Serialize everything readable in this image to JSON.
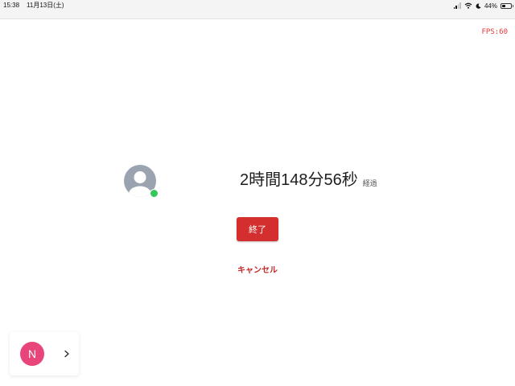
{
  "status_bar": {
    "time": "15:38",
    "date": "11月13日(土)",
    "battery_percent": "44%",
    "battery_level": 0.44,
    "icons": [
      "signal-icon",
      "wifi-icon",
      "moon-icon",
      "battery-icon"
    ]
  },
  "fps": "FPS:60",
  "call": {
    "avatar_icon": "user-avatar-icon",
    "presence": "online",
    "presence_color": "#34c759",
    "elapsed_time": "2時間148分56秒",
    "elapsed_label": "経過"
  },
  "actions": {
    "end_label": "終了",
    "end_color": "#d32f2f",
    "cancel_label": "キャンセル",
    "cancel_color": "#c62828"
  },
  "floating_chip": {
    "initial": "N",
    "avatar_color": "#e8457b",
    "chevron_icon": "chevron-right-icon"
  }
}
